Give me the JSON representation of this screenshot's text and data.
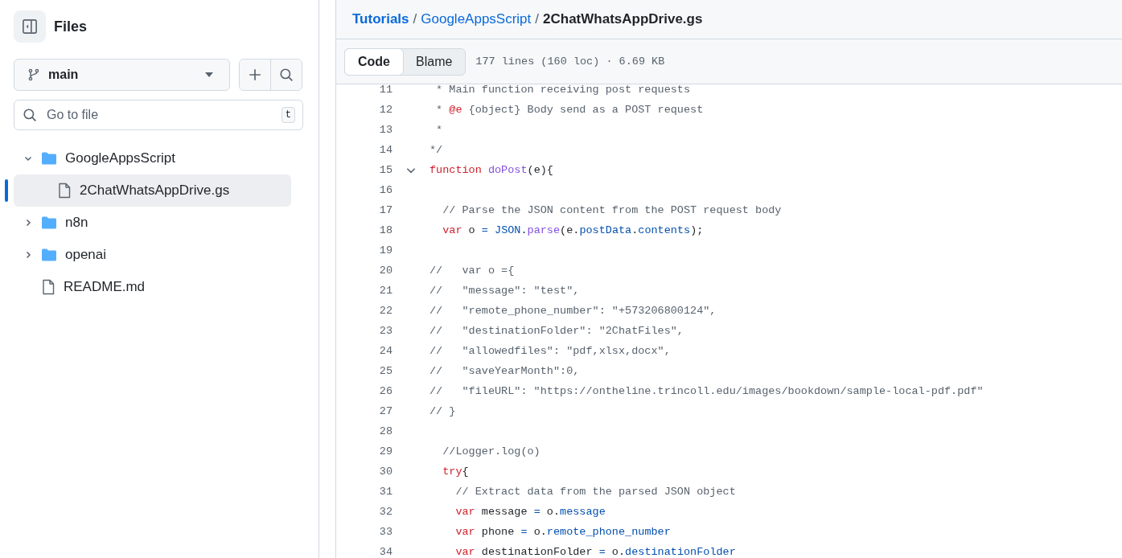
{
  "sidebar": {
    "title": "Files",
    "branch": "main",
    "search": {
      "placeholder": "Go to file",
      "shortcut": "t"
    },
    "tree": [
      {
        "kind": "folder",
        "label": "GoogleAppsScript",
        "expanded": true,
        "selected": false,
        "children": [
          {
            "kind": "file",
            "label": "2ChatWhatsAppDrive.gs",
            "selected": true
          }
        ]
      },
      {
        "kind": "folder",
        "label": "n8n",
        "expanded": false,
        "selected": false
      },
      {
        "kind": "folder",
        "label": "openai",
        "expanded": false,
        "selected": false
      },
      {
        "kind": "file",
        "label": "README.md",
        "selected": false
      }
    ]
  },
  "breadcrumb": [
    {
      "label": "Tutorials",
      "kind": "repo"
    },
    {
      "label": "/",
      "kind": "sep"
    },
    {
      "label": "GoogleAppsScript",
      "kind": "link"
    },
    {
      "label": "/",
      "kind": "sep"
    },
    {
      "label": "2ChatWhatsAppDrive.gs",
      "kind": "current"
    }
  ],
  "tabs": [
    {
      "label": "Code",
      "selected": true
    },
    {
      "label": "Blame",
      "selected": false
    }
  ],
  "file_info": "177 lines (160 loc) · 6.69 KB",
  "code": [
    {
      "n": "11",
      "tokens": [
        {
          "t": " * Main function receiving post requests",
          "kind": "comment"
        }
      ]
    },
    {
      "n": "12",
      "tokens": [
        {
          "t": " * ",
          "kind": "comment"
        },
        {
          "t": "@e",
          "kind": "kw"
        },
        {
          "t": " {object} Body send as a POST request",
          "kind": "comment"
        }
      ]
    },
    {
      "n": "13",
      "tokens": [
        {
          "t": " *",
          "kind": "comment"
        }
      ]
    },
    {
      "n": "14",
      "tokens": [
        {
          "t": "*/",
          "kind": "comment"
        }
      ]
    },
    {
      "n": "15",
      "expanded": true,
      "tokens": [
        {
          "t": "function",
          "kind": "kw"
        },
        {
          "t": " doPost",
          "kind": "func"
        },
        {
          "t": "(e){",
          "kind": "plain"
        }
      ]
    },
    {
      "n": "16"
    },
    {
      "n": "17",
      "tokens": [
        {
          "t": "  // Parse the JSON content from the POST request body",
          "kind": "comment"
        }
      ]
    },
    {
      "n": "18",
      "tokens": [
        {
          "t": "  var",
          "kind": "kw"
        },
        {
          "t": " o ",
          "kind": "plain"
        },
        {
          "t": "=",
          "kind": "const"
        },
        {
          "t": " JSON",
          "kind": "const"
        },
        {
          "t": ".",
          "kind": "plain"
        },
        {
          "t": "parse",
          "kind": "func"
        },
        {
          "t": "(e.",
          "kind": "plain"
        },
        {
          "t": "postData",
          "kind": "const"
        },
        {
          "t": ".",
          "kind": "plain"
        },
        {
          "t": "contents",
          "kind": "const"
        },
        {
          "t": ");",
          "kind": "plain"
        }
      ]
    },
    {
      "n": "19"
    },
    {
      "n": "20",
      "tokens": [
        {
          "t": "//   var o ={",
          "kind": "comment"
        }
      ]
    },
    {
      "n": "21",
      "tokens": [
        {
          "t": "//   \"message\": \"test\",",
          "kind": "comment"
        }
      ]
    },
    {
      "n": "22",
      "tokens": [
        {
          "t": "//   \"remote_phone_number\": \"+573206800124\",",
          "kind": "comment"
        }
      ]
    },
    {
      "n": "23",
      "tokens": [
        {
          "t": "//   \"destinationFolder\": \"2ChatFiles\",",
          "kind": "comment"
        }
      ]
    },
    {
      "n": "24",
      "tokens": [
        {
          "t": "//   \"allowedfiles\": \"pdf,xlsx,docx\",",
          "kind": "comment"
        }
      ]
    },
    {
      "n": "25",
      "tokens": [
        {
          "t": "//   \"saveYearMonth\":0,",
          "kind": "comment"
        }
      ]
    },
    {
      "n": "26",
      "tokens": [
        {
          "t": "//   \"fileURL\": \"https://ontheline.trincoll.edu/images/bookdown/sample-local-pdf.pdf\"",
          "kind": "comment"
        }
      ]
    },
    {
      "n": "27",
      "tokens": [
        {
          "t": "// }",
          "kind": "comment"
        }
      ]
    },
    {
      "n": "28"
    },
    {
      "n": "29",
      "tokens": [
        {
          "t": "  //Logger.log(o)",
          "kind": "comment"
        }
      ]
    },
    {
      "n": "30",
      "tokens": [
        {
          "t": "  try",
          "kind": "kw"
        },
        {
          "t": "{",
          "kind": "plain"
        }
      ]
    },
    {
      "n": "31",
      "tokens": [
        {
          "t": "    // Extract data from the parsed JSON object",
          "kind": "comment"
        }
      ]
    },
    {
      "n": "32",
      "tokens": [
        {
          "t": "    var",
          "kind": "kw"
        },
        {
          "t": " message ",
          "kind": "plain"
        },
        {
          "t": "=",
          "kind": "const"
        },
        {
          "t": " o.",
          "kind": "plain"
        },
        {
          "t": "message",
          "kind": "const"
        }
      ]
    },
    {
      "n": "33",
      "tokens": [
        {
          "t": "    var",
          "kind": "kw"
        },
        {
          "t": " phone ",
          "kind": "plain"
        },
        {
          "t": "=",
          "kind": "const"
        },
        {
          "t": " o.",
          "kind": "plain"
        },
        {
          "t": "remote_phone_number",
          "kind": "const"
        }
      ]
    },
    {
      "n": "34",
      "tokens": [
        {
          "t": "    var",
          "kind": "kw"
        },
        {
          "t": " destinationFolder ",
          "kind": "plain"
        },
        {
          "t": "=",
          "kind": "const"
        },
        {
          "t": " o.",
          "kind": "plain"
        },
        {
          "t": "destinationFolder",
          "kind": "const"
        }
      ]
    }
  ]
}
